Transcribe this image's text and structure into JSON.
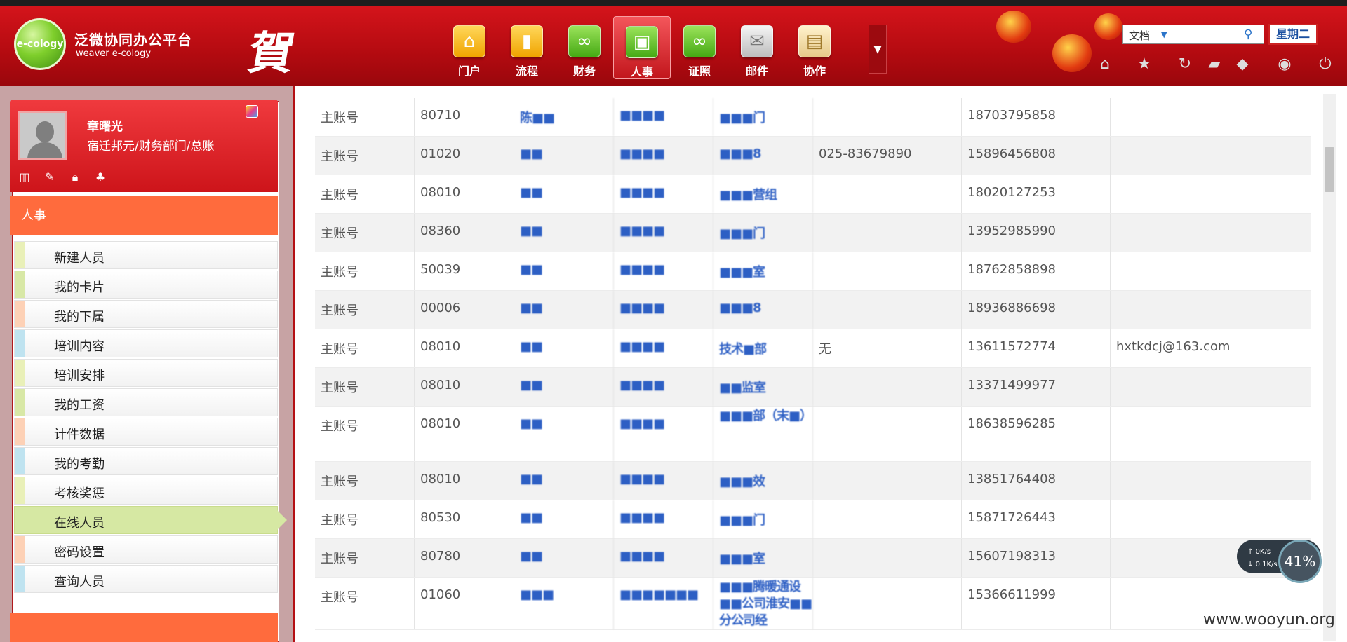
{
  "header": {
    "brand_logo": "e-cology",
    "brand_title": "泛微协同办公平台",
    "brand_subtitle": "weaver e-cology",
    "festival_glyph": "賀",
    "nav_items": [
      {
        "label": "门户",
        "icon": "home-icon",
        "glyph": "⌂"
      },
      {
        "label": "流程",
        "icon": "bar-chart-icon",
        "glyph": "▮"
      },
      {
        "label": "财务",
        "icon": "infinity-icon",
        "glyph": "∞"
      },
      {
        "label": "人事",
        "icon": "card-icon",
        "glyph": "▣"
      },
      {
        "label": "证照",
        "icon": "infinity-icon",
        "glyph": "∞"
      },
      {
        "label": "邮件",
        "icon": "mail-icon",
        "glyph": "✉"
      },
      {
        "label": "协作",
        "icon": "clipboard-icon",
        "glyph": "▤"
      }
    ],
    "search_category": "文档",
    "weekday": "星期二"
  },
  "user": {
    "name": "章曙光",
    "dept": "宿迁邦元/财务部门/总账"
  },
  "sidebar": {
    "section_title": "人事",
    "menu": [
      {
        "label": "新建人员",
        "color": "#e9f0b8"
      },
      {
        "label": "我的卡片",
        "color": "#d8e8a6"
      },
      {
        "label": "我的下属",
        "color": "#fdd1b6"
      },
      {
        "label": "培训内容",
        "color": "#bfe3f0"
      },
      {
        "label": "培训安排",
        "color": "#e9f0b8"
      },
      {
        "label": "我的工资",
        "color": "#d8e8a6"
      },
      {
        "label": "计件数据",
        "color": "#fdd1b6"
      },
      {
        "label": "我的考勤",
        "color": "#bfe3f0"
      },
      {
        "label": "考核奖惩",
        "color": "#e9f0b8"
      },
      {
        "label": "在线人员",
        "color": "#d6e8a3"
      },
      {
        "label": "密码设置",
        "color": "#fdd1b6"
      },
      {
        "label": "查询人员",
        "color": "#bfe3f0"
      }
    ]
  },
  "table": {
    "rows": [
      {
        "type": "主账号",
        "id": "80710",
        "name": "陈■■",
        "company": "■■■■",
        "dept": "■■■门",
        "tel": "",
        "mobile": "18703795858",
        "email": ""
      },
      {
        "type": "主账号",
        "id": "01020",
        "name": "■■",
        "company": "■■■■",
        "dept": "■■■8",
        "tel": "025-83679890",
        "mobile": "15896456808",
        "email": ""
      },
      {
        "type": "主账号",
        "id": "08010",
        "name": "■■",
        "company": "■■■■",
        "dept": "■■■营组",
        "tel": "",
        "mobile": "18020127253",
        "email": ""
      },
      {
        "type": "主账号",
        "id": "08360",
        "name": "■■",
        "company": "■■■■",
        "dept": "■■■门",
        "tel": "",
        "mobile": "13952985990",
        "email": ""
      },
      {
        "type": "主账号",
        "id": "50039",
        "name": "■■",
        "company": "■■■■",
        "dept": "■■■室",
        "tel": "",
        "mobile": "18762858898",
        "email": ""
      },
      {
        "type": "主账号",
        "id": "00006",
        "name": "■■",
        "company": "■■■■",
        "dept": "■■■8",
        "tel": "",
        "mobile": "18936886698",
        "email": ""
      },
      {
        "type": "主账号",
        "id": "08010",
        "name": "■■",
        "company": "■■■■",
        "dept": "技术■部",
        "tel": "无",
        "mobile": "13611572774",
        "email": "hxtkdcj@163.com"
      },
      {
        "type": "主账号",
        "id": "08010",
        "name": "■■",
        "company": "■■■■",
        "dept": "■■监室",
        "tel": "",
        "mobile": "13371499977",
        "email": ""
      },
      {
        "type": "主账号",
        "id": "08010",
        "name": "■■",
        "company": "■■■■",
        "dept": "■■■部（末■）",
        "tel": "",
        "mobile": "18638596285",
        "email": ""
      },
      {
        "type": "主账号",
        "id": "08010",
        "name": "■■",
        "company": "■■■■",
        "dept": "■■■效",
        "tel": "",
        "mobile": "13851764408",
        "email": ""
      },
      {
        "type": "主账号",
        "id": "80530",
        "name": "■■",
        "company": "■■■■",
        "dept": "■■■门",
        "tel": "",
        "mobile": "15871726443",
        "email": ""
      },
      {
        "type": "主账号",
        "id": "80780",
        "name": "■■",
        "company": "■■■■",
        "dept": "■■■室",
        "tel": "",
        "mobile": "15607198313",
        "email": ""
      },
      {
        "type": "主账号",
        "id": "01060",
        "name": "■■■",
        "company": "■■■■■■■",
        "dept": "■■■腾暖通设■■公司淮安■■分公司经",
        "tel": "",
        "mobile": "15366611999",
        "email": ""
      }
    ]
  },
  "widget": {
    "upload": "0K/s",
    "download": "0.1K/s",
    "cpu": "41%"
  },
  "watermark": "www.wooyun.org"
}
